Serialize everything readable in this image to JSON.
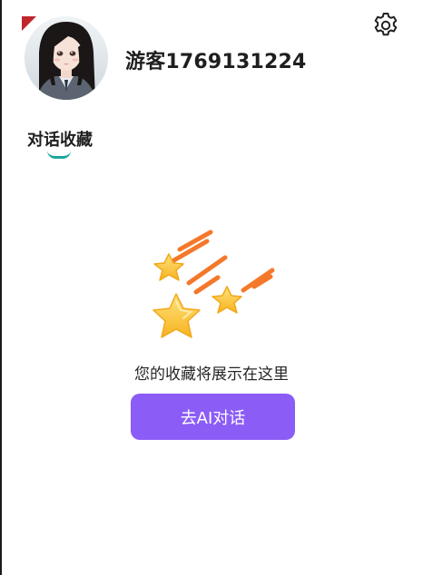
{
  "profile": {
    "username": "游客1769131224",
    "avatar_icon": "avatar-girl-illustration"
  },
  "header": {
    "settings_icon": "gear-icon"
  },
  "tabs": [
    {
      "label": "对话收藏",
      "active": true
    }
  ],
  "empty_state": {
    "illustration_icon": "shooting-stars-icon",
    "message": "您的收藏将展示在这里",
    "button_label": "去AI对话"
  },
  "colors": {
    "accent": "#8b5cf6",
    "tab_indicator": "#1aa59a",
    "star": "#fbbf24",
    "streak": "#f5782a"
  }
}
